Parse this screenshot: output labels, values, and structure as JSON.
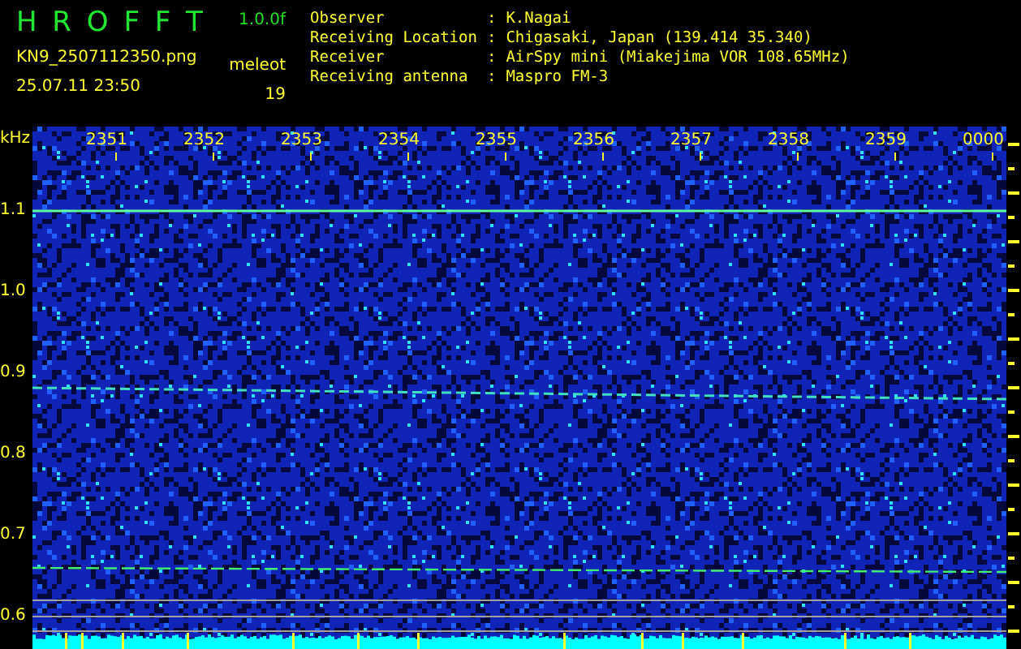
{
  "header": {
    "app_title": "H R O F F T",
    "version": "1.0.0f",
    "filename": "KN9_2507112350.png",
    "datetime": "25.07.11 23:50",
    "meteor_label": "meleot",
    "meteor_count": "19",
    "info": [
      {
        "label": "Observer",
        "separator": ":",
        "value": "K.Nagai"
      },
      {
        "label": "Receiving Location",
        "separator": ":",
        "value": "Chigasaki, Japan (139.414 35.340)"
      },
      {
        "label": "Receiver",
        "separator": ":",
        "value": "AirSpy mini (Miakejima VOR 108.65MHz)"
      },
      {
        "label": "Receiving antenna",
        "separator": ":",
        "value": "Maspro FM-3"
      }
    ]
  },
  "spectrogram": {
    "unit": "kHz",
    "time_labels": [
      "2351",
      "2352",
      "2353",
      "2354",
      "2355",
      "2356",
      "2357",
      "2358",
      "2359",
      "0000"
    ],
    "y_labels": [
      "1.1",
      "1.0",
      "0.9",
      "0.8",
      "0.7",
      "0.6"
    ]
  }
}
